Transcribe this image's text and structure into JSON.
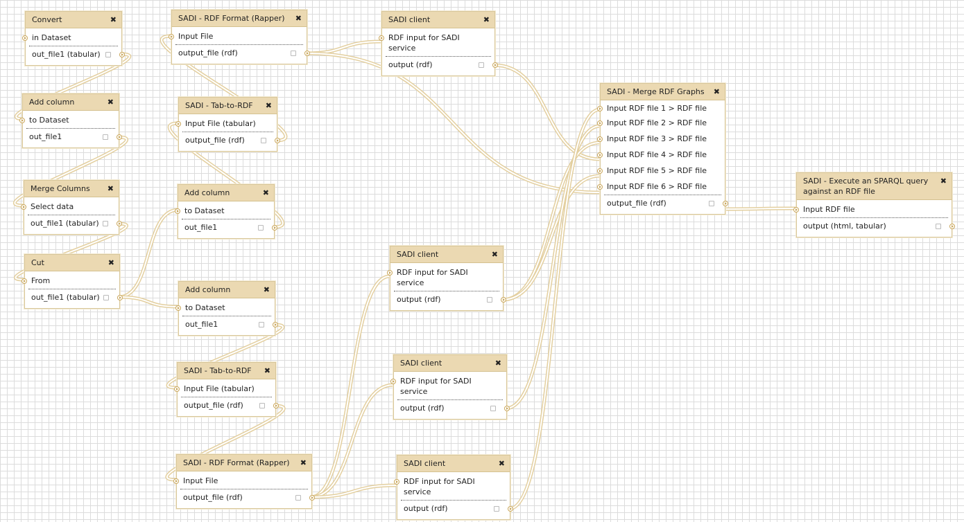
{
  "nodes": [
    {
      "id": "convert",
      "title": "Convert",
      "inputs": [
        "in Dataset"
      ],
      "outputs": [
        "out_file1 (tabular)"
      ]
    },
    {
      "id": "addcol1",
      "title": "Add column",
      "inputs": [
        "to Dataset"
      ],
      "outputs": [
        "out_file1"
      ]
    },
    {
      "id": "merge_cols",
      "title": "Merge Columns",
      "inputs": [
        "Select data"
      ],
      "outputs": [
        "out_file1 (tabular)"
      ]
    },
    {
      "id": "cut",
      "title": "Cut",
      "inputs": [
        "From"
      ],
      "outputs": [
        "out_file1 (tabular)"
      ]
    },
    {
      "id": "rdfformat1",
      "title": "SADI - RDF Format (Rapper)",
      "inputs": [
        "Input File"
      ],
      "outputs": [
        "output_file (rdf)"
      ]
    },
    {
      "id": "tab2rdf1",
      "title": "SADI - Tab-to-RDF",
      "inputs": [
        "Input File (tabular)"
      ],
      "outputs": [
        "output_file (rdf)"
      ]
    },
    {
      "id": "addcol2",
      "title": "Add column",
      "inputs": [
        "to Dataset"
      ],
      "outputs": [
        "out_file1"
      ]
    },
    {
      "id": "addcol3",
      "title": "Add column",
      "inputs": [
        "to Dataset"
      ],
      "outputs": [
        "out_file1"
      ]
    },
    {
      "id": "tab2rdf2",
      "title": "SADI - Tab-to-RDF",
      "inputs": [
        "Input File (tabular)"
      ],
      "outputs": [
        "output_file (rdf)"
      ]
    },
    {
      "id": "rdfformat2",
      "title": "SADI - RDF Format (Rapper)",
      "inputs": [
        "Input File"
      ],
      "outputs": [
        "output_file (rdf)"
      ]
    },
    {
      "id": "sadi1",
      "title": "SADI client",
      "inputs": [
        "RDF input for SADI service"
      ],
      "outputs": [
        "output (rdf)"
      ]
    },
    {
      "id": "sadi2",
      "title": "SADI client",
      "inputs": [
        "RDF input for SADI service"
      ],
      "outputs": [
        "output (rdf)"
      ]
    },
    {
      "id": "sadi3",
      "title": "SADI client",
      "inputs": [
        "RDF input for SADI service"
      ],
      "outputs": [
        "output (rdf)"
      ]
    },
    {
      "id": "sadi4",
      "title": "SADI client",
      "inputs": [
        "RDF input for SADI service"
      ],
      "outputs": [
        "output (rdf)"
      ]
    },
    {
      "id": "mergerdf",
      "title": "SADI - Merge RDF Graphs",
      "inputs": [
        "Input RDF file 1 > RDF file",
        "Input RDF file 2 > RDF file",
        "Input RDF file 3 > RDF file",
        "Input RDF file 4 > RDF file",
        "Input RDF file 5 > RDF file",
        "Input RDF file 6 > RDF file"
      ],
      "outputs": [
        "output_file (rdf)"
      ]
    },
    {
      "id": "sparql",
      "title": "SADI - Execute an SPARQL query against an RDF file",
      "inputs": [
        "Input RDF file"
      ],
      "outputs": [
        "output (html, tabular)"
      ]
    }
  ],
  "colors": {
    "wire": "#e3cf9f",
    "header": "#ebd9b2",
    "border": "#d8c79a"
  },
  "icons": {
    "close": "close-icon",
    "terminal": "terminal-icon"
  },
  "close_glyph": "✖"
}
